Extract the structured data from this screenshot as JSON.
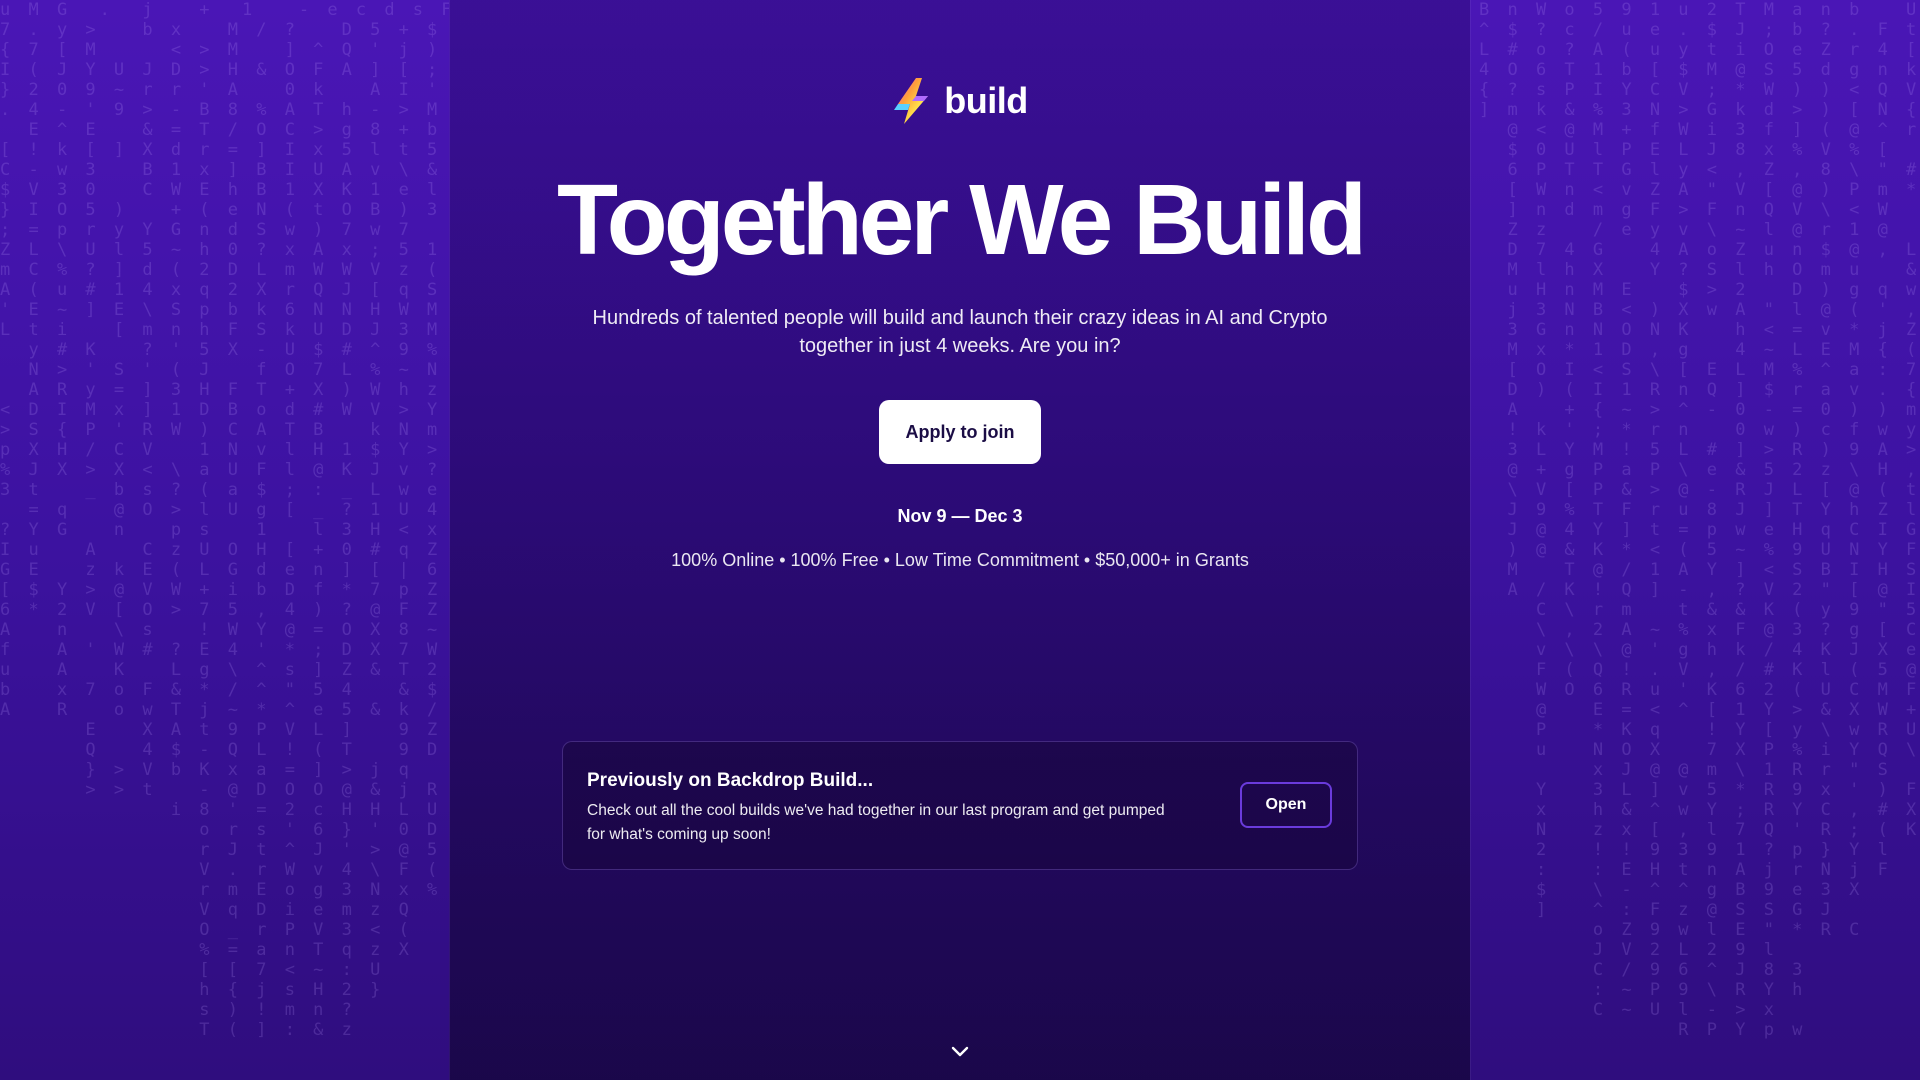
{
  "brand": {
    "name": "build",
    "icon": "lightning-bolt-logo-icon"
  },
  "hero": {
    "title": "Together We Build",
    "subtitle": "Hundreds of talented people will build and launch their crazy ideas in AI and Crypto together in just 4 weeks. Are you in?",
    "cta_label": "Apply to join"
  },
  "event": {
    "dates": "Nov 9 — Dec 3",
    "features": "100% Online • 100% Free • Low Time Commitment • $50,000+ in Grants"
  },
  "previous": {
    "title": "Previously on Backdrop Build...",
    "description": "Check out all the cool builds we've had together in our last program and get pumped for what's coming up soon!",
    "button_label": "Open"
  },
  "scroll_icon": "chevron-down-icon",
  "colors": {
    "background": "#2c0b78",
    "side_panels": "#4a16b6",
    "button_bg": "#ffffff",
    "button_text": "#1b0d45",
    "open_border": "#6a3bdc"
  }
}
